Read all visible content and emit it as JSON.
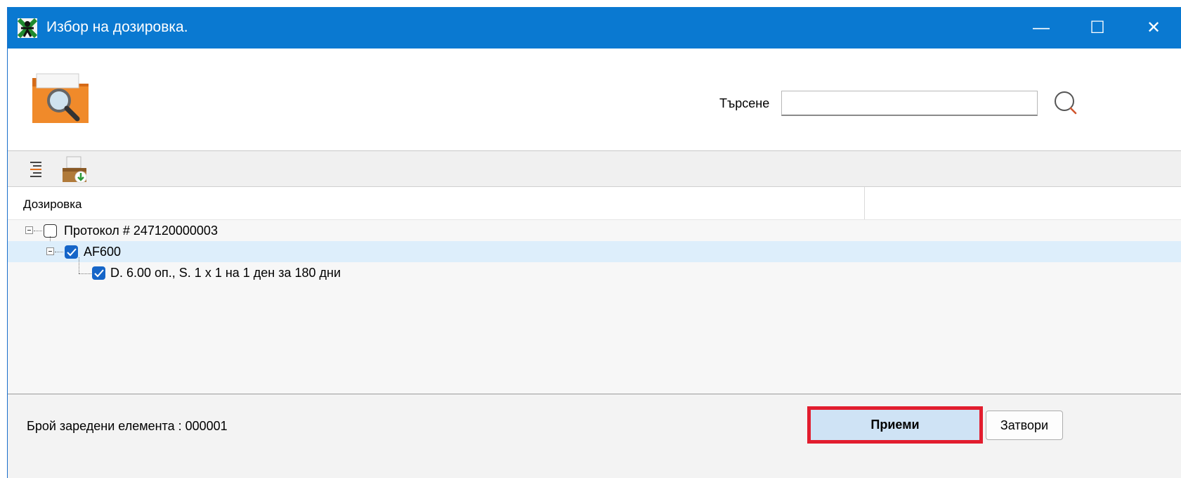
{
  "window": {
    "title": "Избор на дозировка.",
    "controls": {
      "minimize": "—",
      "maximize": "☐",
      "close": "✕"
    }
  },
  "search": {
    "label": "Търсене",
    "value": "",
    "placeholder": ""
  },
  "grid": {
    "column_header": "Дозировка",
    "tree": [
      {
        "label": "Протокол # 247120000003",
        "checked": false,
        "level": 0,
        "expanded": true
      },
      {
        "label": "AF600",
        "checked": true,
        "level": 1,
        "expanded": true,
        "selected": true
      },
      {
        "label": "D. 6.00 оп., S. 1 x 1 на 1 ден за 180 дни",
        "checked": true,
        "level": 2
      }
    ]
  },
  "footer": {
    "count_text": "Брой заредени елемента : 000001",
    "accept_label": "Приеми",
    "close_label": "Затвори"
  },
  "colors": {
    "titlebar": "#0a79d1",
    "accent_check": "#1565c8",
    "highlight_border": "#e21d2e",
    "selected_row": "#ddeefb"
  }
}
